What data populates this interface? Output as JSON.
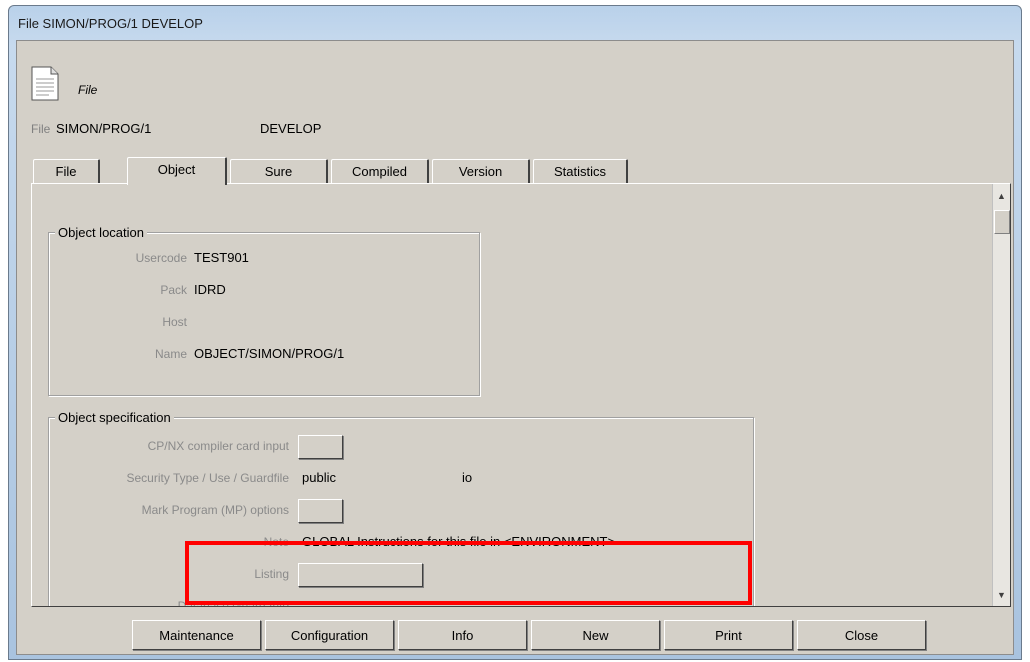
{
  "window": {
    "title": "File SIMON/PROG/1 DEVELOP"
  },
  "header": {
    "type_label": "File",
    "file_label": "File",
    "file_name": "SIMON/PROG/1",
    "environment": "DEVELOP"
  },
  "tabs": [
    {
      "label": "File",
      "active": false
    },
    {
      "label": "Object",
      "active": true
    },
    {
      "label": "Sure",
      "active": false
    },
    {
      "label": "Compiled",
      "active": false
    },
    {
      "label": "Version",
      "active": false
    },
    {
      "label": "Statistics",
      "active": false
    }
  ],
  "object_location": {
    "title": "Object location",
    "usercode_label": "Usercode",
    "usercode": "TEST901",
    "pack_label": "Pack",
    "pack": "IDRD",
    "host_label": "Host",
    "host": "",
    "name_label": "Name",
    "name": "OBJECT/SIMON/PROG/1"
  },
  "object_specification": {
    "title": "Object specification",
    "compiler_card_label": "CP/NX compiler card input",
    "security_label": "Security  Type / Use / Guardfile",
    "security_type": "public",
    "security_use": "io",
    "mark_program_label": "Mark Program (MP) options",
    "note_label": "Note",
    "note": "GLOBAL Instructions for this file in <ENVIRONMENT>",
    "listing_label": "Listing",
    "db_guard_label": "Database Guard Info"
  },
  "buttons": {
    "maintenance": "Maintenance",
    "configuration": "Configuration",
    "info": "Info",
    "new": "New",
    "print": "Print",
    "close": "Close"
  },
  "colors": {
    "highlight": "#ff0000",
    "panel": "#d4d0c8"
  }
}
